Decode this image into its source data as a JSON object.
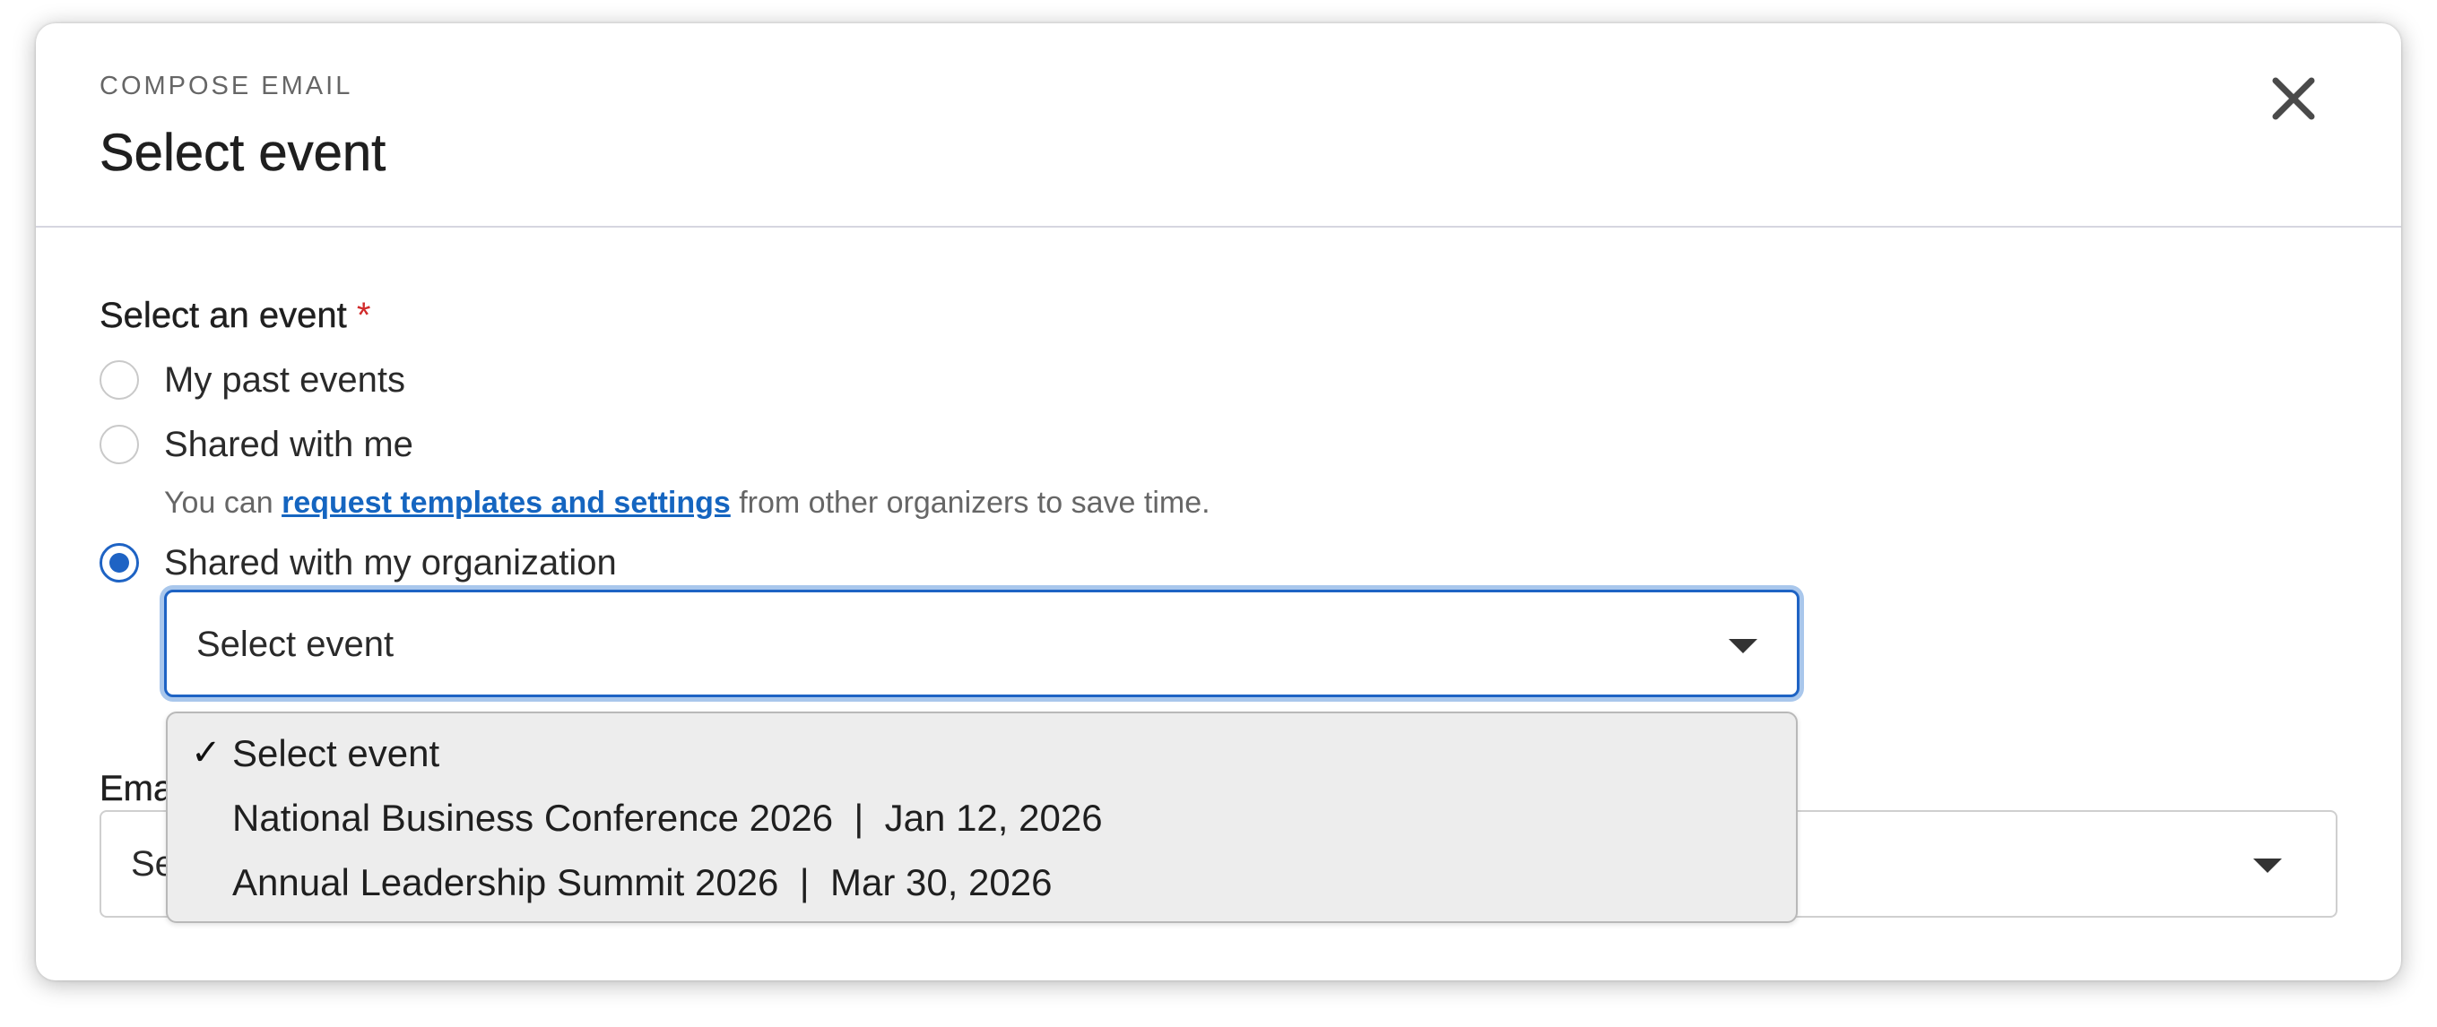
{
  "header": {
    "eyebrow": "COMPOSE EMAIL",
    "title": "Select event",
    "close_icon": "close-icon"
  },
  "event_field": {
    "label": "Select an event",
    "required_marker": "*",
    "options": [
      {
        "label": "My past events",
        "checked": false
      },
      {
        "label": "Shared with me",
        "checked": false
      },
      {
        "label": "Shared with my organization",
        "checked": true
      }
    ],
    "helper_prefix": "You can ",
    "helper_link": "request templates and settings",
    "helper_suffix": " from other organizers to save time."
  },
  "event_select": {
    "value": "Select event",
    "dropdown_items": [
      {
        "label": "Select event",
        "selected": true,
        "check": "✓"
      },
      {
        "label": "National Business Conference 2026  |  Jan 12, 2026",
        "selected": false
      },
      {
        "label": "Annual Leadership Summit 2026  |  Mar 30, 2026",
        "selected": false
      }
    ]
  },
  "email_field": {
    "label_visible": "Ema",
    "select_value_visible": "Se"
  },
  "colors": {
    "accent": "#1e63c4",
    "focus_ring": "#a9c7ec",
    "required": "#d12b2b",
    "link": "#1565c0",
    "dropdown_bg": "#ededed"
  }
}
